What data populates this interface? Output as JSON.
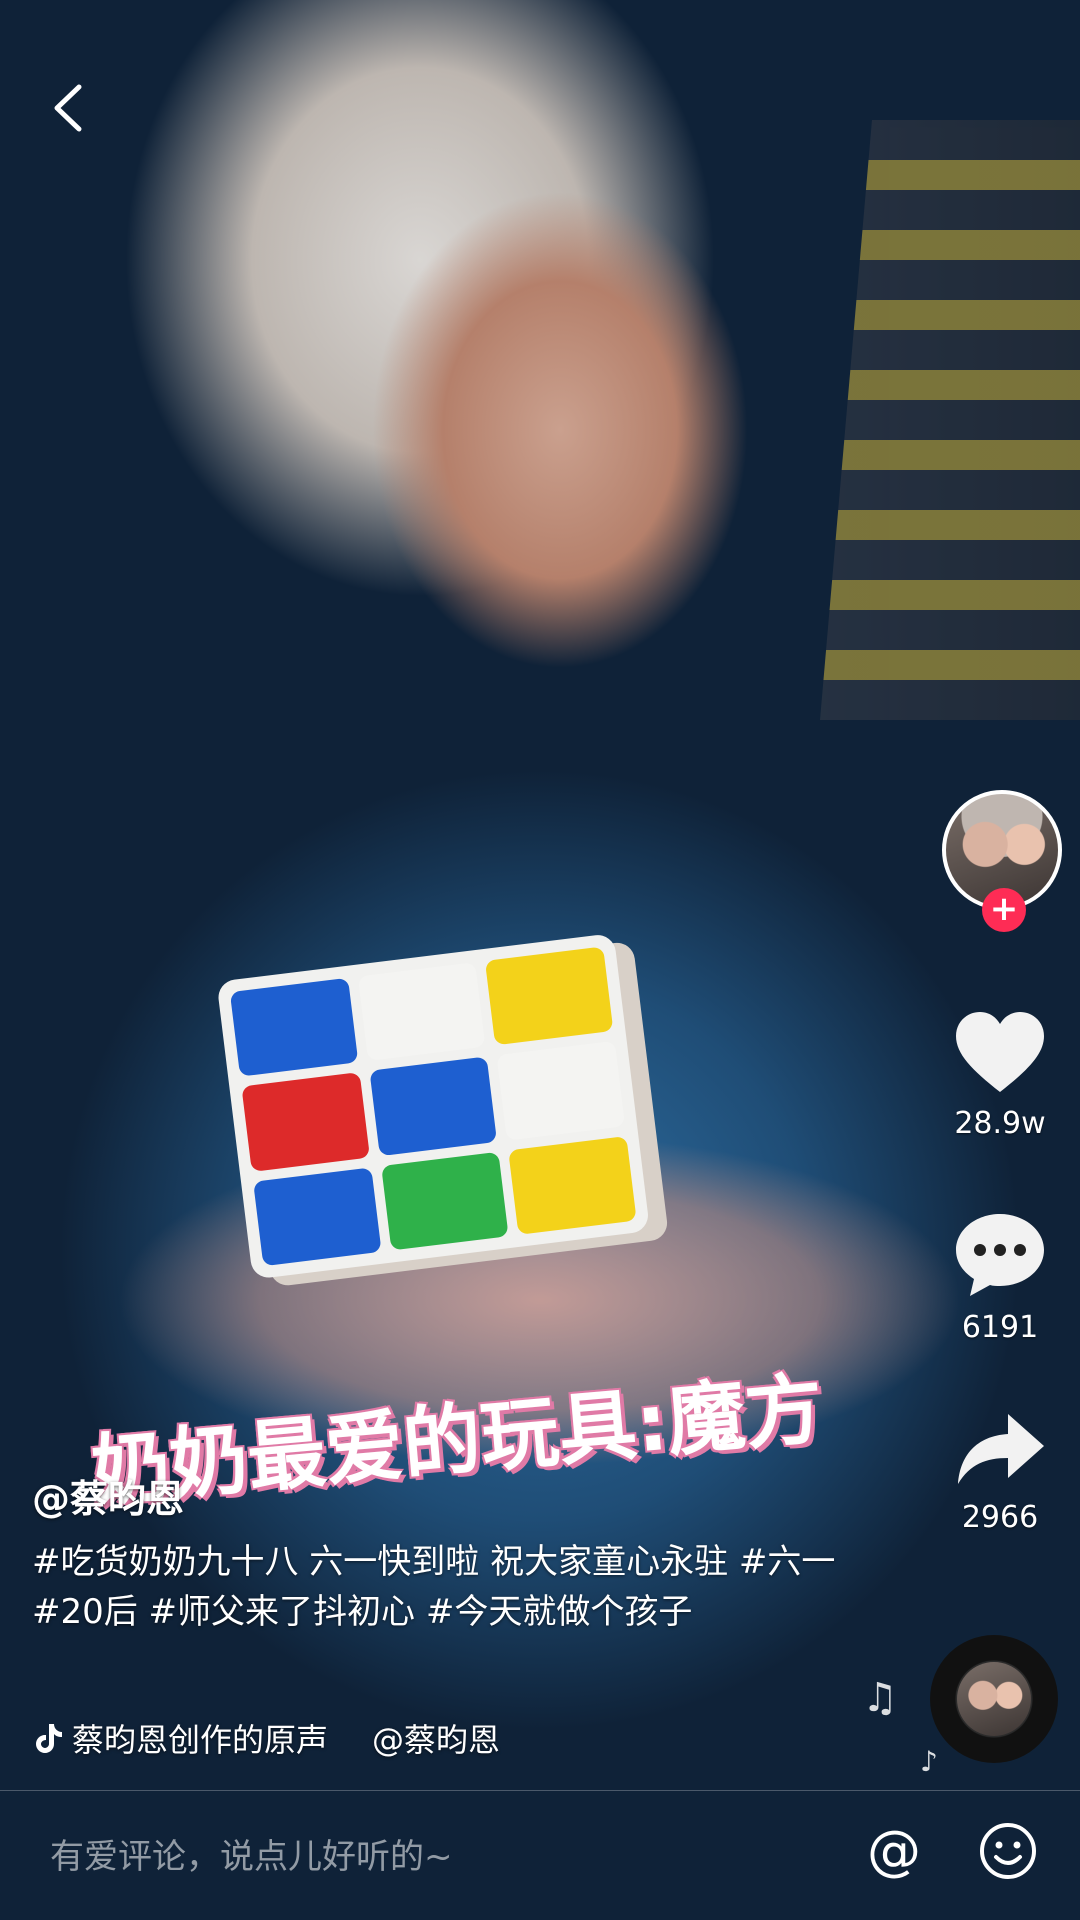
{
  "video": {
    "overlay_caption": "奶奶最爱的玩具:魔方"
  },
  "cube": {
    "stickers": [
      "#1e5fd0",
      "#f4f4f2",
      "#f3d21a",
      "#dd2a2a",
      "#1e5fd0",
      "#f4f4f2",
      "#1e5fd0",
      "#2fb14a",
      "#f3d21a"
    ]
  },
  "rail": {
    "like_count": "28.9w",
    "comment_count": "6191",
    "share_count": "2966"
  },
  "post": {
    "author": "@蔡昀恩",
    "description": "#吃货奶奶九十八 六一快到啦 祝大家童心永驻 #六一 #20后 #师父来了抖初心 #今天就做个孩子",
    "music_title": "蔡昀恩创作的原声",
    "music_author": "@蔡昀恩"
  },
  "comment_bar": {
    "placeholder": "有爱评论，说点儿好听的~",
    "at_symbol": "@"
  },
  "colors": {
    "accent": "#fe2c55",
    "caption_outline": "#e07aa6"
  }
}
